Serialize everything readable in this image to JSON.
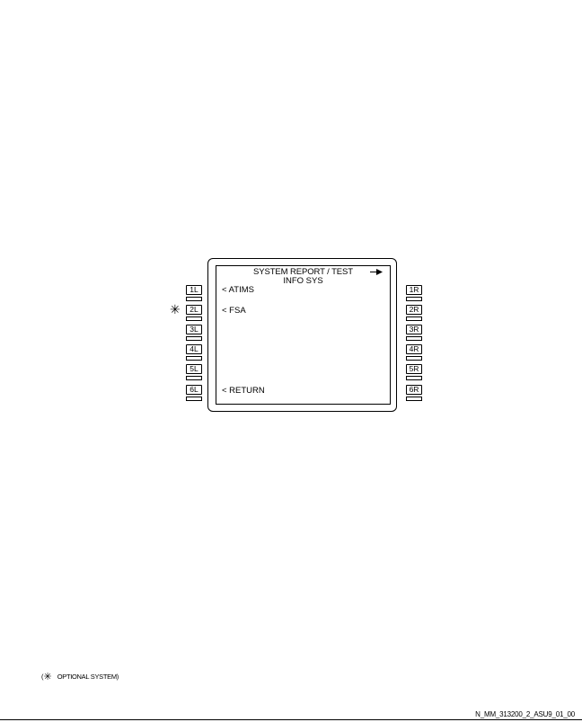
{
  "screen": {
    "title": "SYSTEM REPORT / TEST",
    "subtitle": "INFO SYS",
    "title_arrow_icon": "right-arrow",
    "lines": {
      "l1": "< ATIMS",
      "l2": "< FSA",
      "l6": "< RETURN"
    }
  },
  "keys": {
    "left": [
      "1L",
      "2L",
      "3L",
      "4L",
      "5L",
      "6L"
    ],
    "right": [
      "1R",
      "2R",
      "3R",
      "4R",
      "5R",
      "6R"
    ]
  },
  "optional_marker": "✳",
  "legend": {
    "open": "(",
    "star": "✳",
    "text": "OPTIONAL SYSTEM)"
  },
  "figure_reference": "N_MM_313200_2_ASU9_01_00"
}
